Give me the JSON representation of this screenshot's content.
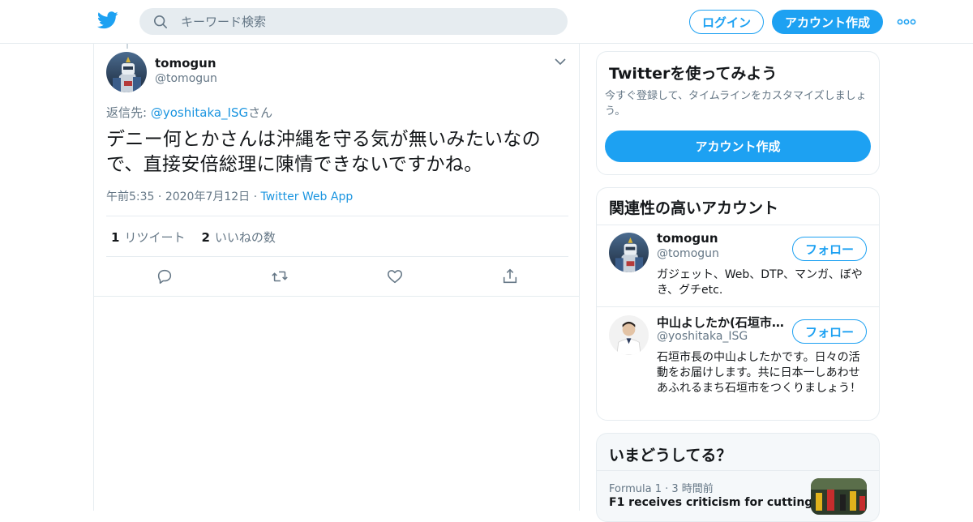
{
  "header": {
    "search_placeholder": "キーワード検索",
    "login_label": "ログイン",
    "signup_label": "アカウント作成"
  },
  "tweet": {
    "author_name": "tomogun",
    "author_handle": "@tomogun",
    "reply_prefix": "返信先: ",
    "reply_mention": "@yoshitaka_ISG",
    "reply_suffix": "さん",
    "text": "デニー何とかさんは沖縄を守る気が無いみたいなので、直接安倍総理に陳情できないですかね。",
    "time": "午前5:35",
    "date": "2020年7月12日",
    "app": "Twitter Web App",
    "retweet_count": "1",
    "retweet_label": "リツイート",
    "like_count": "2",
    "like_label": "いいねの数"
  },
  "signup_card": {
    "title": "Twitterを使ってみよう",
    "description": "今すぐ登録して、タイムラインをカスタマイズしましょう。",
    "button_label": "アカウント作成"
  },
  "related": {
    "title": "関連性の高いアカウント",
    "accounts": [
      {
        "name": "tomogun",
        "handle": "@tomogun",
        "bio": "ガジェット、Web、DTP、マンガ、ぼやき、グチetc.",
        "follow_label": "フォロー"
      },
      {
        "name": "中山よしたか(石垣市長)",
        "handle": "@yoshitaka_ISG",
        "bio": "石垣市長の中山よしたかです。日々の活動をお届けします。共に日本一しあわせあふれるまち石垣市をつくりましょう！",
        "follow_label": "フォロー"
      }
    ]
  },
  "trends": {
    "title": "いまどうしてる？",
    "item": {
      "category": "Formula 1",
      "time": "3 時間前",
      "headline": "F1 receives criticism for cutting"
    }
  },
  "colors": {
    "accent": "#1da1f2",
    "link": "#1b95e0",
    "secondary_text": "#657786",
    "border": "#e6ecf0"
  }
}
